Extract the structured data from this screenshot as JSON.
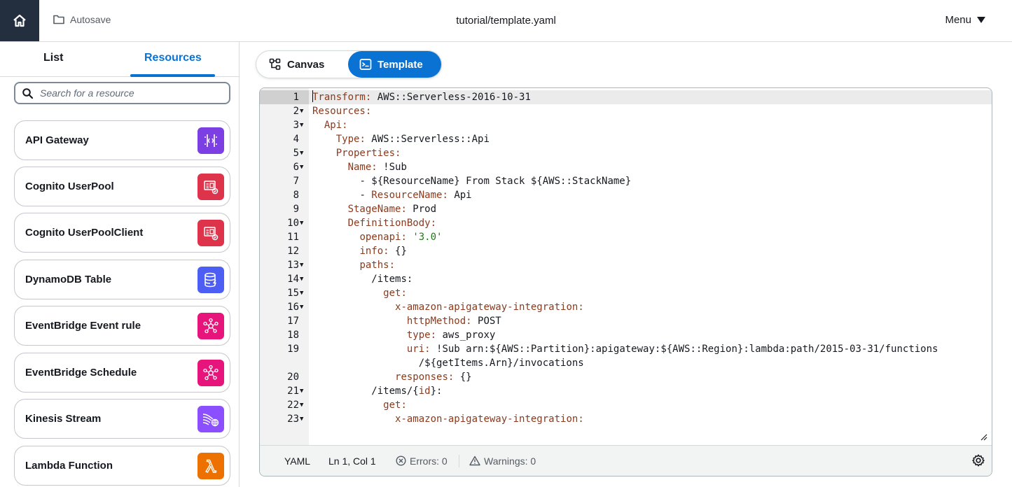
{
  "topbar": {
    "autosave_label": "Autosave",
    "file_title": "tutorial/template.yaml",
    "menu_label": "Menu"
  },
  "sidebar": {
    "tabs": [
      {
        "label": "List",
        "active": false
      },
      {
        "label": "Resources",
        "active": true
      }
    ],
    "search_placeholder": "Search for a resource",
    "resources": [
      {
        "label": "API Gateway",
        "icon": "api-gateway-icon",
        "color": "#7b3fe4"
      },
      {
        "label": "Cognito UserPool",
        "icon": "cognito-icon",
        "color": "#dd344c"
      },
      {
        "label": "Cognito UserPoolClient",
        "icon": "cognito-icon",
        "color": "#dd344c"
      },
      {
        "label": "DynamoDB Table",
        "icon": "dynamodb-icon",
        "color": "#4d5ef5"
      },
      {
        "label": "EventBridge Event rule",
        "icon": "eventbridge-icon",
        "color": "#e7157b"
      },
      {
        "label": "EventBridge Schedule",
        "icon": "eventbridge-icon",
        "color": "#e7157b"
      },
      {
        "label": "Kinesis Stream",
        "icon": "kinesis-icon",
        "color": "#8c4fff"
      },
      {
        "label": "Lambda Function",
        "icon": "lambda-icon",
        "color": "#ed7100"
      }
    ]
  },
  "view_toggle": {
    "canvas_label": "Canvas",
    "template_label": "Template",
    "active": "Template"
  },
  "editor": {
    "lines": [
      {
        "n": "1",
        "fold": false,
        "ind": 0,
        "key": "Transform",
        "val": " AWS::Serverless-2016-10-31"
      },
      {
        "n": "2",
        "fold": true,
        "ind": 0,
        "key": "Resources",
        "val": ""
      },
      {
        "n": "3",
        "fold": true,
        "ind": 2,
        "key": "Api",
        "val": ""
      },
      {
        "n": "4",
        "fold": false,
        "ind": 4,
        "key": "Type",
        "val": " AWS::Serverless::Api"
      },
      {
        "n": "5",
        "fold": true,
        "ind": 4,
        "key": "Properties",
        "val": ""
      },
      {
        "n": "6",
        "fold": true,
        "ind": 6,
        "key": "Name",
        "val": " !Sub"
      },
      {
        "n": "7",
        "fold": false,
        "ind": 8,
        "plain": "- ${ResourceName} From Stack ${AWS::StackName}"
      },
      {
        "n": "8",
        "fold": false,
        "ind": 8,
        "dash": true,
        "key": "ResourceName",
        "val": " Api"
      },
      {
        "n": "9",
        "fold": false,
        "ind": 6,
        "key": "StageName",
        "val": " Prod"
      },
      {
        "n": "10",
        "fold": true,
        "ind": 6,
        "key": "DefinitionBody",
        "val": ""
      },
      {
        "n": "11",
        "fold": false,
        "ind": 8,
        "key": "openapi",
        "val": " ",
        "str": "'3.0'"
      },
      {
        "n": "12",
        "fold": false,
        "ind": 8,
        "key": "info",
        "val": " {}"
      },
      {
        "n": "13",
        "fold": true,
        "ind": 8,
        "key": "paths",
        "val": ""
      },
      {
        "n": "14",
        "fold": true,
        "ind": 10,
        "plainkey": "/items",
        "val": ""
      },
      {
        "n": "15",
        "fold": true,
        "ind": 12,
        "key": "get",
        "val": ""
      },
      {
        "n": "16",
        "fold": true,
        "ind": 14,
        "key": "x-amazon-apigateway-integration",
        "val": ""
      },
      {
        "n": "17",
        "fold": false,
        "ind": 16,
        "key": "httpMethod",
        "val": " POST"
      },
      {
        "n": "18",
        "fold": false,
        "ind": 16,
        "key": "type",
        "val": " aws_proxy"
      },
      {
        "n": "19",
        "fold": false,
        "ind": 16,
        "key": "uri",
        "val": " !Sub arn:${AWS::Partition}:apigateway:${AWS::Region}:lambda:path/2015-03-31/functions"
      },
      {
        "n": "",
        "fold": false,
        "ind": 18,
        "plain": "/${getItems.Arn}/invocations"
      },
      {
        "n": "20",
        "fold": false,
        "ind": 14,
        "key": "responses",
        "val": " {}"
      },
      {
        "n": "21",
        "fold": true,
        "ind": 10,
        "plainkey": "/items/{id}",
        "val": ""
      },
      {
        "n": "22",
        "fold": true,
        "ind": 12,
        "key": "get",
        "val": ""
      },
      {
        "n": "23",
        "fold": true,
        "ind": 14,
        "key": "x-amazon-apigateway-integration",
        "val": ""
      }
    ]
  },
  "status": {
    "language": "YAML",
    "position": "Ln 1, Col 1",
    "errors": "Errors: 0",
    "warnings": "Warnings: 0"
  }
}
